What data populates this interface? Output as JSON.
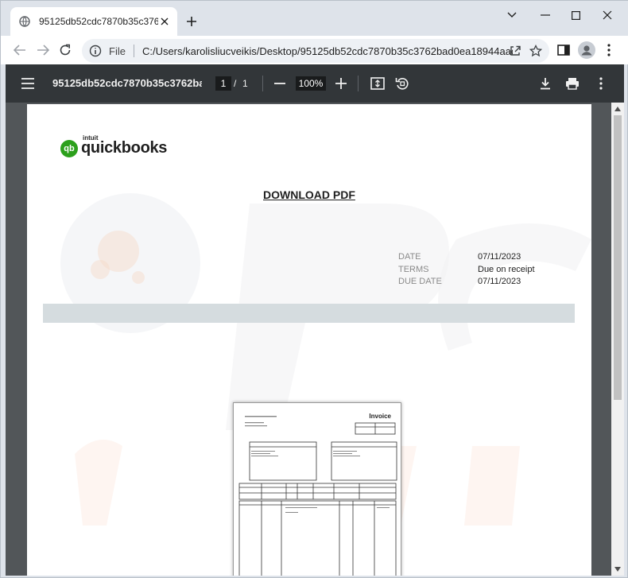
{
  "browser": {
    "tab_title": "95125db52cdc7870b35c3762bad0ea18944aaed95",
    "omnibox": {
      "scheme_label": "File",
      "url": "C:/Users/karolisliucveikis/Desktop/95125db52cdc7870b35c3762bad0ea18944aaed95..."
    },
    "icons": [
      "globe-icon",
      "close-icon",
      "plus-icon",
      "chevron-down-icon",
      "minimize-icon",
      "maximize-icon",
      "back-icon",
      "forward-icon",
      "reload-icon",
      "info-icon",
      "share-icon",
      "star-icon",
      "sidepanel-icon",
      "profile-icon",
      "kebab-icon"
    ]
  },
  "pdf_viewer": {
    "title": "95125db52cdc7870b35c3762ba...",
    "page_current": "1",
    "page_separator": "/",
    "page_total": "1",
    "zoom": "100%",
    "icons": [
      "menu-icon",
      "zoom-out-icon",
      "zoom-in-icon",
      "fit-page-icon",
      "rotate-icon",
      "download-icon",
      "print-icon",
      "more-icon"
    ]
  },
  "document": {
    "logo": {
      "intuit": "intuit",
      "wordmark": "quickbooks"
    },
    "download_link": "DOWNLOAD PDF",
    "meta": [
      {
        "label": "DATE",
        "value": "07/11/2023"
      },
      {
        "label": "TERMS",
        "value": "Due on receipt"
      },
      {
        "label": "DUE DATE",
        "value": "07/11/2023"
      }
    ],
    "invoice_image": {
      "title": "Invoice"
    }
  },
  "colors": {
    "pdf_toolbar": "#323639",
    "viewer_bg": "#525659",
    "band": "#d5dcdf",
    "qb_green": "#2ca01c"
  }
}
